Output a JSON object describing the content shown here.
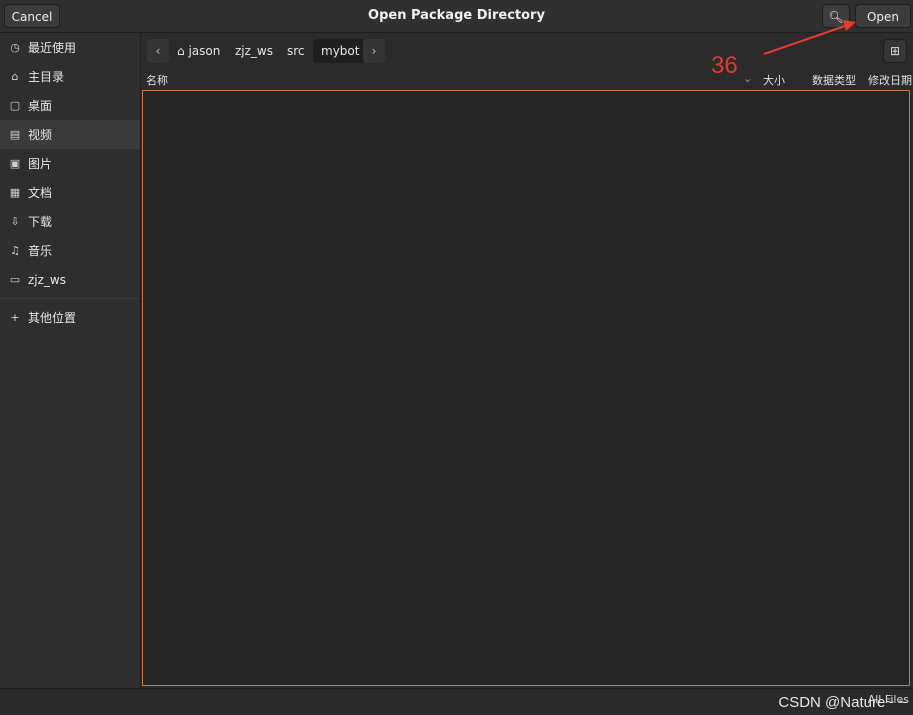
{
  "header": {
    "cancel_label": "Cancel",
    "title": "Open Package Directory",
    "search_icon": "search-icon",
    "open_label": "Open"
  },
  "sidebar": {
    "items": [
      {
        "icon": "clock-icon",
        "label": "最近使用"
      },
      {
        "icon": "home-icon",
        "label": "主目录"
      },
      {
        "icon": "desktop-icon",
        "label": "桌面"
      },
      {
        "icon": "video-icon",
        "label": "视频"
      },
      {
        "icon": "image-icon",
        "label": "图片"
      },
      {
        "icon": "document-icon",
        "label": "文档"
      },
      {
        "icon": "download-icon",
        "label": "下载"
      },
      {
        "icon": "music-icon",
        "label": "音乐"
      },
      {
        "icon": "folder-icon",
        "label": "zjz_ws"
      },
      {
        "icon": "plus-icon",
        "label": "其他位置"
      }
    ]
  },
  "pathbar": {
    "back_icon": "chevron-left-icon",
    "crumbs": [
      "jason",
      "zjz_ws",
      "src",
      "mybot"
    ],
    "forward_icon": "chevron-right-icon",
    "new_folder_icon": "new-folder-icon"
  },
  "columns": {
    "name": "名称",
    "size": "大小",
    "type": "数据类型",
    "modified": "修改日期"
  },
  "annotation": {
    "number": "36"
  },
  "footer": {
    "filter": "All Files",
    "watermark": "CSDN @Nature~ ~"
  }
}
